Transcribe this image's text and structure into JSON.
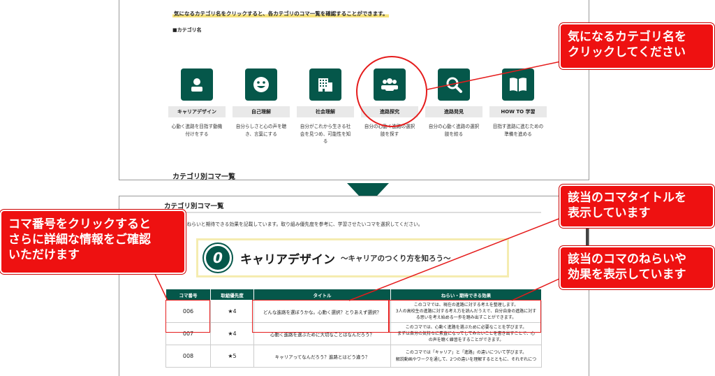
{
  "top": {
    "intro": "気になるカテゴリ名をクリックすると、各カテゴリのコマ一覧を確認することができます。",
    "category_heading": "■カテゴリ名",
    "categories": [
      {
        "label": "キャリアデザイン",
        "desc": "心動く進路を目指す動機付けをする",
        "icon": "person-icon"
      },
      {
        "label": "自己理解",
        "desc": "自分らしさと心の声を聴き、言葉にする",
        "icon": "smiley-icon"
      },
      {
        "label": "社会理解",
        "desc": "自分がこれから生きる社会を見つめ、可能性を知る",
        "icon": "building-icon"
      },
      {
        "label": "進路探究",
        "desc": "自分の心動く進路の選択肢を探す",
        "icon": "group-icon"
      },
      {
        "label": "進路発見",
        "desc": "自分の心動く進路の選択肢を絞る",
        "icon": "magnifier-icon"
      },
      {
        "label": "HOW TO 学習",
        "desc": "目指す進路に進むための準備を進める",
        "icon": "book-icon"
      }
    ],
    "next_heading": "カテゴリ別コマ一覧"
  },
  "bottom": {
    "title": "カテゴリ別コマ一覧",
    "intro": "コマのねらいと期待できる効果を記載しています。取り組み優先度を参考に、学習させたいコマを選択してください。",
    "banner": {
      "num": "0",
      "title": "キャリアデザイン",
      "sub": "〜キャリアのつくり方を知ろう〜"
    },
    "columns": [
      "コマ番号",
      "取組優先度",
      "タイトル",
      "ねらい・期待できる効果"
    ],
    "rows": [
      {
        "num": "006",
        "priority": "★4",
        "title": "どんな進路を選ぼうかな。心動く選択？とりあえず選択？",
        "aim": [
          "このコマでは、現在の進路に対する考えを整理します。",
          "3人の高校生の進路に対する考え方を読んだうえで、自分自身の進路に対する思いを考え始める一歩を踏み出すことができます。"
        ]
      },
      {
        "num": "007",
        "priority": "★4",
        "title": "心動く進路を選ぶために大切なことはなんだろう？",
        "aim": [
          "このコマでは、心動く進路を選ぶために必要なことを学びます。",
          "まずは自分の気持ちに素直になってしてみたいことを書き出すことで、心の声を聴く練習をすることができます。"
        ]
      },
      {
        "num": "008",
        "priority": "★5",
        "title": "キャリアってなんだろう？進路とはどう違う？",
        "aim": [
          "このコマでは「キャリア」と「進路」の違いについて学びます。",
          "解説動画やワークを通して、2つの違いを理解するとともに、それぞれにつ"
        ]
      }
    ]
  },
  "callouts": {
    "category": [
      "気になるカテゴリ名を",
      "クリックしてください"
    ],
    "title": [
      "該当のコマタイトルを",
      "表示しています"
    ],
    "number": [
      "コマ番号をクリックすると",
      "さらに詳細な情報をご確認",
      "いただけます"
    ],
    "aim": [
      "該当のコマのねらいや",
      "効果を表示しています"
    ]
  },
  "colors": {
    "brand_green": "#05574a",
    "callout_red": "#ee1111",
    "highlight_yellow": "#f6e27a"
  }
}
